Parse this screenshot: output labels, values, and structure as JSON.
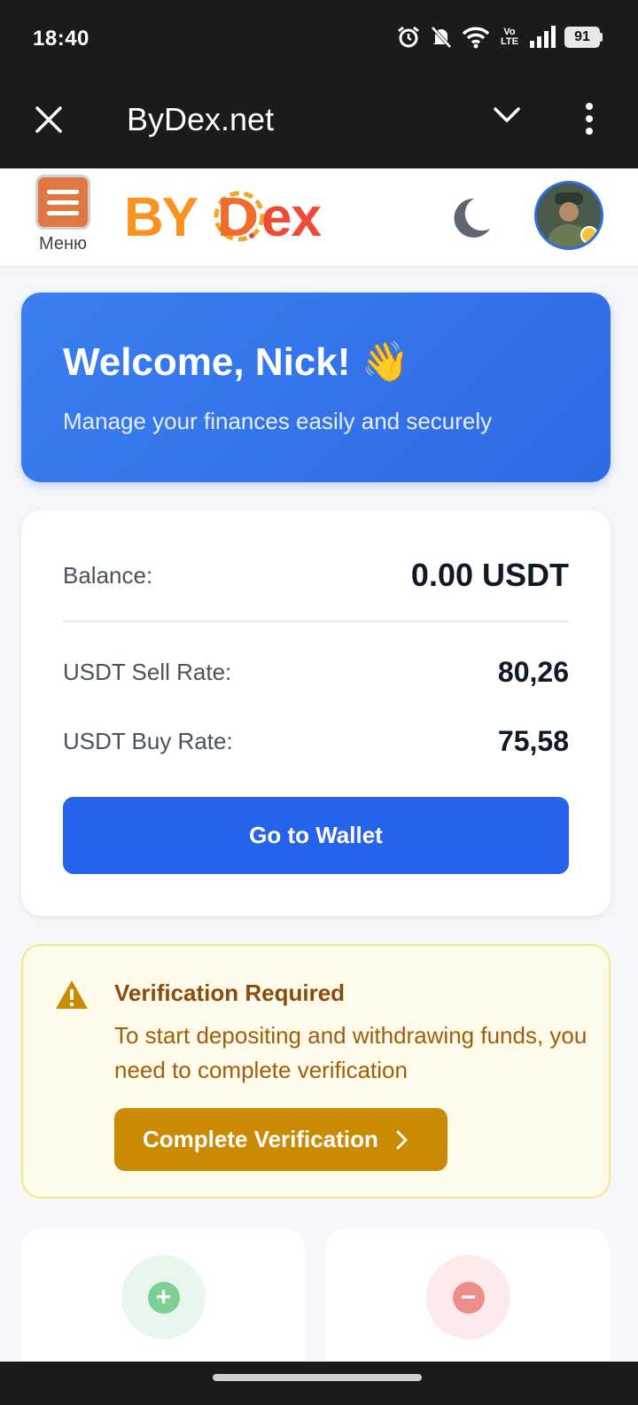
{
  "status_bar": {
    "time": "18:40",
    "battery": "91",
    "network_label": "Vo LTE"
  },
  "browser": {
    "title": "ByDex.net"
  },
  "header": {
    "menu_label": "Меню",
    "logo": "BYDex"
  },
  "welcome": {
    "title": "Welcome, Nick! 👋",
    "subtitle": "Manage your finances easily and securely"
  },
  "balance": {
    "balance_label": "Balance:",
    "balance_value": "0.00 USDT",
    "sell_label": "USDT Sell Rate:",
    "sell_value": "80,26",
    "buy_label": "USDT Buy Rate:",
    "buy_value": "75,58",
    "wallet_button": "Go to Wallet"
  },
  "verification": {
    "title": "Verification Required",
    "message": "To start depositing and withdrawing funds, you need to complete verification",
    "button": "Complete Verification"
  },
  "actions": {
    "deposit_icon": "plus-icon",
    "withdraw_icon": "minus-icon"
  },
  "colors": {
    "primary": "#2563eb",
    "warning_bg": "#fefbea",
    "warning_button": "#ca8a04",
    "brand_orange": "#f7931e"
  }
}
